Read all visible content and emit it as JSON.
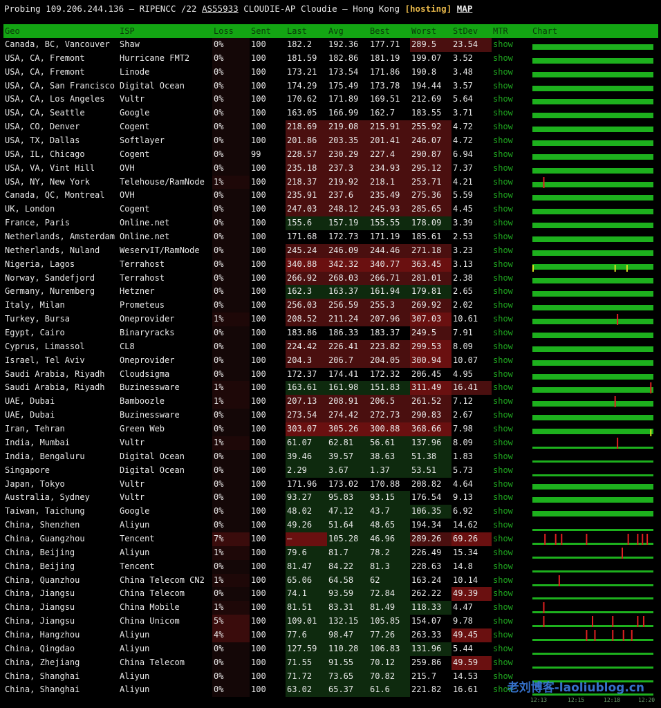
{
  "header": {
    "prefix": "Probing 109.206.244.136 – RIPENCC /22 ",
    "asn": "AS55933",
    "middle": " CLOUDIE-AP Cloudie – Hong Kong ",
    "tag": "[hosting]",
    "map": "MAP"
  },
  "columns": [
    "Geo",
    "ISP",
    "Loss",
    "Sent",
    "Last",
    "Avg",
    "Best",
    "Worst",
    "StDev",
    "MTR",
    "Chart"
  ],
  "colors": {
    "header_bg": "#13a513",
    "good_cell": "#0e2a0e",
    "bad_cell": "#4a0f0f",
    "worse_cell": "#6a1010",
    "chart_green": "#1db01d",
    "spike_red": "#e02020",
    "spike_yellow": "#d8e020"
  },
  "rows": [
    {
      "geo": "Canada, BC, Vancouver",
      "isp": "Shaw",
      "loss": "0%",
      "sent": "100",
      "last": "182.2",
      "avg": "192.36",
      "best": "177.71",
      "worst": "289.5",
      "stdev": "23.54",
      "mtr": "show",
      "tone": "n",
      "wtone": "b",
      "stone": "b",
      "spikes": []
    },
    {
      "geo": "USA, CA, Fremont",
      "isp": "Hurricane FMT2",
      "loss": "0%",
      "sent": "100",
      "last": "181.59",
      "avg": "182.86",
      "best": "181.19",
      "worst": "199.07",
      "stdev": "3.52",
      "mtr": "show",
      "tone": "n",
      "wtone": "n",
      "stone": "n",
      "spikes": []
    },
    {
      "geo": "USA, CA, Fremont",
      "isp": "Linode",
      "loss": "0%",
      "sent": "100",
      "last": "173.21",
      "avg": "173.54",
      "best": "171.86",
      "worst": "190.8",
      "stdev": "3.48",
      "mtr": "show",
      "tone": "n",
      "wtone": "n",
      "stone": "n",
      "spikes": []
    },
    {
      "geo": "USA, CA, San Francisco",
      "isp": "Digital Ocean",
      "loss": "0%",
      "sent": "100",
      "last": "174.29",
      "avg": "175.49",
      "best": "173.78",
      "worst": "194.44",
      "stdev": "3.57",
      "mtr": "show",
      "tone": "n",
      "wtone": "n",
      "stone": "n",
      "spikes": []
    },
    {
      "geo": "USA, CA, Los Angeles",
      "isp": "Vultr",
      "loss": "0%",
      "sent": "100",
      "last": "170.62",
      "avg": "171.89",
      "best": "169.51",
      "worst": "212.69",
      "stdev": "5.64",
      "mtr": "show",
      "tone": "n",
      "wtone": "n",
      "stone": "n",
      "spikes": []
    },
    {
      "geo": "USA, CA, Seattle",
      "isp": "Google",
      "loss": "0%",
      "sent": "100",
      "last": "163.05",
      "avg": "166.99",
      "best": "162.7",
      "worst": "183.55",
      "stdev": "3.71",
      "mtr": "show",
      "tone": "n",
      "wtone": "n",
      "stone": "n",
      "spikes": []
    },
    {
      "geo": "USA, CO, Denver",
      "isp": "Cogent",
      "loss": "0%",
      "sent": "100",
      "last": "218.69",
      "avg": "219.08",
      "best": "215.91",
      "worst": "255.92",
      "stdev": "4.72",
      "mtr": "show",
      "tone": "b",
      "wtone": "b",
      "stone": "n",
      "spikes": []
    },
    {
      "geo": "USA, TX, Dallas",
      "isp": "Softlayer",
      "loss": "0%",
      "sent": "100",
      "last": "201.86",
      "avg": "203.35",
      "best": "201.41",
      "worst": "246.07",
      "stdev": "4.72",
      "mtr": "show",
      "tone": "b",
      "wtone": "b",
      "stone": "n",
      "spikes": []
    },
    {
      "geo": "USA, IL, Chicago",
      "isp": "Cogent",
      "loss": "0%",
      "sent": "99",
      "last": "228.57",
      "avg": "230.29",
      "best": "227.4",
      "worst": "290.87",
      "stdev": "6.94",
      "mtr": "show",
      "tone": "b",
      "wtone": "b",
      "stone": "n",
      "spikes": []
    },
    {
      "geo": "USA, VA, Vint Hill",
      "isp": "OVH",
      "loss": "0%",
      "sent": "100",
      "last": "235.18",
      "avg": "237.3",
      "best": "234.93",
      "worst": "295.12",
      "stdev": "7.37",
      "mtr": "show",
      "tone": "b",
      "wtone": "b",
      "stone": "n",
      "spikes": []
    },
    {
      "geo": "USA, NY, New York",
      "isp": "Telehouse/RamNode",
      "loss": "1%",
      "sent": "100",
      "last": "218.37",
      "avg": "219.92",
      "best": "218.1",
      "worst": "253.71",
      "stdev": "4.21",
      "mtr": "show",
      "tone": "b",
      "wtone": "b",
      "stone": "n",
      "spikes": [
        {
          "p": 0.09,
          "c": "r"
        }
      ]
    },
    {
      "geo": "Canada, QC, Montreal",
      "isp": "OVH",
      "loss": "0%",
      "sent": "100",
      "last": "235.91",
      "avg": "237.6",
      "best": "235.49",
      "worst": "275.36",
      "stdev": "5.59",
      "mtr": "show",
      "tone": "b",
      "wtone": "b",
      "stone": "n",
      "spikes": []
    },
    {
      "geo": "UK, London",
      "isp": "Cogent",
      "loss": "0%",
      "sent": "100",
      "last": "247.03",
      "avg": "248.12",
      "best": "245.93",
      "worst": "285.65",
      "stdev": "4.45",
      "mtr": "show",
      "tone": "b",
      "wtone": "b",
      "stone": "n",
      "spikes": []
    },
    {
      "geo": "France, Paris",
      "isp": "Online.net",
      "loss": "0%",
      "sent": "100",
      "last": "155.6",
      "avg": "157.19",
      "best": "155.55",
      "worst": "178.09",
      "stdev": "3.39",
      "mtr": "show",
      "tone": "g",
      "wtone": "g",
      "stone": "n",
      "spikes": []
    },
    {
      "geo": "Netherlands, Amsterdam",
      "isp": "Online.net",
      "loss": "0%",
      "sent": "100",
      "last": "171.68",
      "avg": "172.73",
      "best": "171.19",
      "worst": "185.61",
      "stdev": "2.53",
      "mtr": "show",
      "tone": "n",
      "wtone": "n",
      "stone": "n",
      "spikes": []
    },
    {
      "geo": "Netherlands, Nuland",
      "isp": "WeservIT/RamNode",
      "loss": "0%",
      "sent": "100",
      "last": "245.24",
      "avg": "246.09",
      "best": "244.46",
      "worst": "271.18",
      "stdev": "3.23",
      "mtr": "show",
      "tone": "b",
      "wtone": "b",
      "stone": "n",
      "spikes": []
    },
    {
      "geo": "Nigeria, Lagos",
      "isp": "Terrahost",
      "loss": "0%",
      "sent": "100",
      "last": "340.88",
      "avg": "342.32",
      "best": "340.77",
      "worst": "363.45",
      "stdev": "3.13",
      "mtr": "show",
      "tone": "w",
      "wtone": "w",
      "stone": "n",
      "spikes": [
        {
          "p": 0.0,
          "c": "y"
        },
        {
          "p": 0.69,
          "c": "y"
        },
        {
          "p": 0.79,
          "c": "y"
        }
      ]
    },
    {
      "geo": "Norway, Sandefjord",
      "isp": "Terrahost",
      "loss": "0%",
      "sent": "100",
      "last": "266.92",
      "avg": "268.03",
      "best": "266.71",
      "worst": "281.01",
      "stdev": "2.38",
      "mtr": "show",
      "tone": "b",
      "wtone": "b",
      "stone": "n",
      "spikes": []
    },
    {
      "geo": "Germany, Nuremberg",
      "isp": "Hetzner",
      "loss": "0%",
      "sent": "100",
      "last": "162.3",
      "avg": "163.37",
      "best": "161.94",
      "worst": "179.81",
      "stdev": "2.65",
      "mtr": "show",
      "tone": "g",
      "wtone": "g",
      "stone": "n",
      "spikes": []
    },
    {
      "geo": "Italy, Milan",
      "isp": "Prometeus",
      "loss": "0%",
      "sent": "100",
      "last": "256.03",
      "avg": "256.59",
      "best": "255.3",
      "worst": "269.92",
      "stdev": "2.02",
      "mtr": "show",
      "tone": "b",
      "wtone": "b",
      "stone": "n",
      "spikes": []
    },
    {
      "geo": "Turkey, Bursa",
      "isp": "Oneprovider",
      "loss": "1%",
      "sent": "100",
      "last": "208.52",
      "avg": "211.24",
      "best": "207.96",
      "worst": "307.03",
      "stdev": "10.61",
      "mtr": "show",
      "tone": "b",
      "wtone": "w",
      "stone": "n",
      "spikes": [
        {
          "p": 0.71,
          "c": "r"
        }
      ]
    },
    {
      "geo": "Egypt, Cairo",
      "isp": "Binaryracks",
      "loss": "0%",
      "sent": "100",
      "last": "183.86",
      "avg": "186.33",
      "best": "183.37",
      "worst": "249.5",
      "stdev": "7.91",
      "mtr": "show",
      "tone": "n",
      "wtone": "b",
      "stone": "n",
      "spikes": []
    },
    {
      "geo": "Cyprus, Limassol",
      "isp": "CL8",
      "loss": "0%",
      "sent": "100",
      "last": "224.42",
      "avg": "226.41",
      "best": "223.82",
      "worst": "299.53",
      "stdev": "8.09",
      "mtr": "show",
      "tone": "b",
      "wtone": "w",
      "stone": "n",
      "spikes": []
    },
    {
      "geo": "Israel, Tel Aviv",
      "isp": "Oneprovider",
      "loss": "0%",
      "sent": "100",
      "last": "204.3",
      "avg": "206.7",
      "best": "204.05",
      "worst": "300.94",
      "stdev": "10.07",
      "mtr": "show",
      "tone": "b",
      "wtone": "w",
      "stone": "n",
      "spikes": []
    },
    {
      "geo": "Saudi Arabia, Riyadh",
      "isp": "Cloudsigma",
      "loss": "0%",
      "sent": "100",
      "last": "172.37",
      "avg": "174.41",
      "best": "172.32",
      "worst": "206.45",
      "stdev": "4.95",
      "mtr": "show",
      "tone": "n",
      "wtone": "n",
      "stone": "n",
      "spikes": []
    },
    {
      "geo": "Saudi Arabia, Riyadh",
      "isp": "Buzinessware",
      "loss": "1%",
      "sent": "100",
      "last": "163.61",
      "avg": "161.98",
      "best": "151.83",
      "worst": "311.49",
      "stdev": "16.41",
      "mtr": "show",
      "tone": "g",
      "wtone": "w",
      "stone": "b",
      "spikes": [
        {
          "p": 0.99,
          "c": "r"
        }
      ]
    },
    {
      "geo": "UAE, Dubai",
      "isp": "Bamboozle",
      "loss": "1%",
      "sent": "100",
      "last": "207.13",
      "avg": "208.91",
      "best": "206.5",
      "worst": "261.52",
      "stdev": "7.12",
      "mtr": "show",
      "tone": "b",
      "wtone": "b",
      "stone": "n",
      "spikes": [
        {
          "p": 0.69,
          "c": "r"
        }
      ]
    },
    {
      "geo": "UAE, Dubai",
      "isp": "Buzinessware",
      "loss": "0%",
      "sent": "100",
      "last": "273.54",
      "avg": "274.42",
      "best": "272.73",
      "worst": "290.83",
      "stdev": "2.67",
      "mtr": "show",
      "tone": "b",
      "wtone": "b",
      "stone": "n",
      "spikes": []
    },
    {
      "geo": "Iran, Tehran",
      "isp": "Green Web",
      "loss": "0%",
      "sent": "100",
      "last": "303.07",
      "avg": "305.26",
      "best": "300.88",
      "worst": "368.66",
      "stdev": "7.98",
      "mtr": "show",
      "tone": "w",
      "wtone": "w",
      "stone": "n",
      "spikes": [
        {
          "p": 0.99,
          "c": "y"
        }
      ]
    },
    {
      "geo": "India, Mumbai",
      "isp": "Vultr",
      "loss": "1%",
      "sent": "100",
      "last": "61.07",
      "avg": "62.81",
      "best": "56.61",
      "worst": "137.96",
      "stdev": "8.09",
      "mtr": "show",
      "tone": "g",
      "wtone": "g",
      "stone": "n",
      "spikes": [
        {
          "p": 0.71,
          "c": "r"
        }
      ]
    },
    {
      "geo": "India, Bengaluru",
      "isp": "Digital Ocean",
      "loss": "0%",
      "sent": "100",
      "last": "39.46",
      "avg": "39.57",
      "best": "38.63",
      "worst": "51.38",
      "stdev": "1.83",
      "mtr": "show",
      "tone": "g",
      "wtone": "g",
      "stone": "n",
      "spikes": []
    },
    {
      "geo": "Singapore",
      "isp": "Digital Ocean",
      "loss": "0%",
      "sent": "100",
      "last": "2.29",
      "avg": "3.67",
      "best": "1.37",
      "worst": "53.51",
      "stdev": "5.73",
      "mtr": "show",
      "tone": "g",
      "wtone": "g",
      "stone": "n",
      "spikes": []
    },
    {
      "geo": "Japan, Tokyo",
      "isp": "Vultr",
      "loss": "0%",
      "sent": "100",
      "last": "171.96",
      "avg": "173.02",
      "best": "170.88",
      "worst": "208.82",
      "stdev": "4.64",
      "mtr": "show",
      "tone": "n",
      "wtone": "n",
      "stone": "n",
      "spikes": []
    },
    {
      "geo": "Australia, Sydney",
      "isp": "Vultr",
      "loss": "0%",
      "sent": "100",
      "last": "93.27",
      "avg": "95.83",
      "best": "93.15",
      "worst": "176.54",
      "stdev": "9.13",
      "mtr": "show",
      "tone": "g",
      "wtone": "n",
      "stone": "n",
      "spikes": []
    },
    {
      "geo": "Taiwan, Taichung",
      "isp": "Google",
      "loss": "0%",
      "sent": "100",
      "last": "48.02",
      "avg": "47.12",
      "best": "43.7",
      "worst": "106.35",
      "stdev": "6.92",
      "mtr": "show",
      "tone": "g",
      "wtone": "g",
      "stone": "n",
      "spikes": []
    },
    {
      "geo": "China, Shenzhen",
      "isp": "Aliyun",
      "loss": "0%",
      "sent": "100",
      "last": "49.26",
      "avg": "51.64",
      "best": "48.65",
      "worst": "194.34",
      "stdev": "14.62",
      "mtr": "show",
      "tone": "g",
      "wtone": "n",
      "stone": "n",
      "spikes": []
    },
    {
      "geo": "China, Guangzhou",
      "isp": "Tencent",
      "loss": "7%",
      "sent": "100",
      "last": "–",
      "avg": "105.28",
      "best": "46.96",
      "worst": "289.26",
      "stdev": "69.26",
      "mtr": "show",
      "tone": "g",
      "wtone": "b",
      "stone": "w",
      "lastTone": "w",
      "spikes": [
        {
          "p": 0.1,
          "c": "r"
        },
        {
          "p": 0.19,
          "c": "r"
        },
        {
          "p": 0.24,
          "c": "r"
        },
        {
          "p": 0.45,
          "c": "r"
        },
        {
          "p": 0.8,
          "c": "r"
        },
        {
          "p": 0.88,
          "c": "r"
        },
        {
          "p": 0.92,
          "c": "r"
        },
        {
          "p": 0.96,
          "c": "r"
        }
      ]
    },
    {
      "geo": "China, Beijing",
      "isp": "Aliyun",
      "loss": "1%",
      "sent": "100",
      "last": "79.6",
      "avg": "81.7",
      "best": "78.2",
      "worst": "226.49",
      "stdev": "15.34",
      "mtr": "show",
      "tone": "g",
      "wtone": "n",
      "stone": "n",
      "spikes": [
        {
          "p": 0.75,
          "c": "r"
        }
      ]
    },
    {
      "geo": "China, Beijing",
      "isp": "Tencent",
      "loss": "0%",
      "sent": "100",
      "last": "81.47",
      "avg": "84.22",
      "best": "81.3",
      "worst": "228.63",
      "stdev": "14.8",
      "mtr": "show",
      "tone": "g",
      "wtone": "n",
      "stone": "n",
      "spikes": []
    },
    {
      "geo": "China, Quanzhou",
      "isp": "China Telecom CN2",
      "loss": "1%",
      "sent": "100",
      "last": "65.06",
      "avg": "64.58",
      "best": "62",
      "worst": "163.24",
      "stdev": "10.14",
      "mtr": "show",
      "tone": "g",
      "wtone": "n",
      "stone": "n",
      "spikes": [
        {
          "p": 0.22,
          "c": "r"
        }
      ]
    },
    {
      "geo": "China, Jiangsu",
      "isp": "China Telecom",
      "loss": "0%",
      "sent": "100",
      "last": "74.1",
      "avg": "93.59",
      "best": "72.84",
      "worst": "262.22",
      "stdev": "49.39",
      "mtr": "show",
      "tone": "g",
      "wtone": "n",
      "stone": "w",
      "spikes": []
    },
    {
      "geo": "China, Jiangsu",
      "isp": "China Mobile",
      "loss": "1%",
      "sent": "100",
      "last": "81.51",
      "avg": "83.31",
      "best": "81.49",
      "worst": "118.33",
      "stdev": "4.47",
      "mtr": "show",
      "tone": "g",
      "wtone": "g",
      "stone": "n",
      "spikes": [
        {
          "p": 0.09,
          "c": "r"
        }
      ]
    },
    {
      "geo": "China, Jiangsu",
      "isp": "China Unicom",
      "loss": "5%",
      "sent": "100",
      "last": "109.01",
      "avg": "132.15",
      "best": "105.85",
      "worst": "154.07",
      "stdev": "9.78",
      "mtr": "show",
      "tone": "g",
      "wtone": "n",
      "stone": "n",
      "spikes": [
        {
          "p": 0.09,
          "c": "r"
        },
        {
          "p": 0.5,
          "c": "r"
        },
        {
          "p": 0.67,
          "c": "r"
        },
        {
          "p": 0.88,
          "c": "r"
        },
        {
          "p": 0.93,
          "c": "r"
        }
      ]
    },
    {
      "geo": "China, Hangzhou",
      "isp": "Aliyun",
      "loss": "4%",
      "sent": "100",
      "last": "77.6",
      "avg": "98.47",
      "best": "77.26",
      "worst": "263.33",
      "stdev": "49.45",
      "mtr": "show",
      "tone": "g",
      "wtone": "n",
      "stone": "w",
      "spikes": [
        {
          "p": 0.45,
          "c": "r"
        },
        {
          "p": 0.52,
          "c": "r"
        },
        {
          "p": 0.67,
          "c": "r"
        },
        {
          "p": 0.76,
          "c": "r"
        },
        {
          "p": 0.83,
          "c": "r"
        }
      ]
    },
    {
      "geo": "China, Qingdao",
      "isp": "Aliyun",
      "loss": "0%",
      "sent": "100",
      "last": "127.59",
      "avg": "110.28",
      "best": "106.83",
      "worst": "131.96",
      "stdev": "5.44",
      "mtr": "show",
      "tone": "g",
      "wtone": "g",
      "stone": "n",
      "spikes": []
    },
    {
      "geo": "China, Zhejiang",
      "isp": "China Telecom",
      "loss": "0%",
      "sent": "100",
      "last": "71.55",
      "avg": "91.55",
      "best": "70.12",
      "worst": "259.86",
      "stdev": "49.59",
      "mtr": "show",
      "tone": "g",
      "wtone": "n",
      "stone": "w",
      "spikes": []
    },
    {
      "geo": "China, Shanghai",
      "isp": "Aliyun",
      "loss": "0%",
      "sent": "100",
      "last": "71.72",
      "avg": "73.65",
      "best": "70.82",
      "worst": "215.7",
      "stdev": "14.53",
      "mtr": "show",
      "tone": "g",
      "wtone": "n",
      "stone": "n",
      "spikes": []
    },
    {
      "geo": "China, Shanghai",
      "isp": "Aliyun",
      "loss": "0%",
      "sent": "100",
      "last": "63.02",
      "avg": "65.37",
      "best": "61.6",
      "worst": "221.82",
      "stdev": "16.61",
      "mtr": "show",
      "tone": "g",
      "wtone": "n",
      "stone": "n",
      "spikes": []
    }
  ],
  "chart_xaxis": [
    "12:13",
    "12:15",
    "12:18",
    "12:20"
  ],
  "watermark": "老刘博客-laoliublog.cn"
}
